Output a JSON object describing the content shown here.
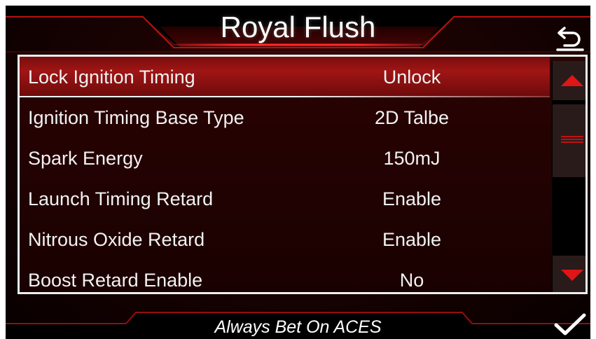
{
  "header": {
    "title": "Royal Flush"
  },
  "settings": [
    {
      "label": "Lock Ignition Timing",
      "value": "Unlock"
    },
    {
      "label": "Ignition Timing Base Type",
      "value": "2D Talbe"
    },
    {
      "label": "Spark Energy",
      "value": "150mJ"
    },
    {
      "label": "Launch Timing Retard",
      "value": "Enable"
    },
    {
      "label": "Nitrous Oxide Retard",
      "value": "Enable"
    },
    {
      "label": "Boost Retard Enable",
      "value": "No"
    }
  ],
  "footer": {
    "tagline": "Always Bet On ACES"
  },
  "icons": {
    "back": "back-arrow-icon",
    "confirm": "checkmark-icon",
    "scroll_up": "triangle-up-icon",
    "scroll_down": "triangle-down-icon",
    "scroll_thumb": "grip-lines-icon"
  },
  "colors": {
    "accent_red": "#e01515",
    "selected_row": "#a01515",
    "background": "#1a0202",
    "text": "#f2f2f2"
  }
}
